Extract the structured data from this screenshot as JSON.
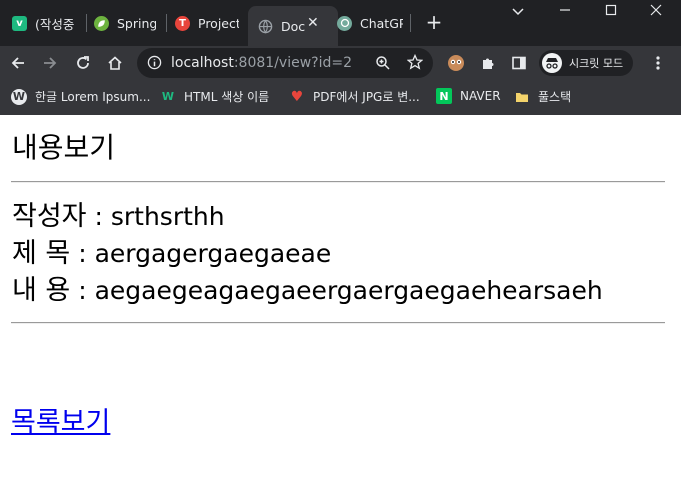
{
  "browser": {
    "tabs": [
      {
        "title": "(작성중",
        "favicon": "v-icon",
        "color": "#1eb980"
      },
      {
        "title": "Spring",
        "favicon": "spring-leaf-icon",
        "color": "#6db33f"
      },
      {
        "title": "Project",
        "favicon": "project-icon",
        "color": "#e8453c"
      },
      {
        "title": "Doc",
        "favicon": "globe-icon",
        "color": "#9aa0a6",
        "active": true
      },
      {
        "title": "ChatGP",
        "favicon": "chatgpt-icon",
        "color": "#74aa9c"
      }
    ],
    "address": {
      "host": "localhost",
      "path": ":8081/view?id=2"
    },
    "incognito_label": "시크릿 모드",
    "bookmarks": [
      {
        "label": "한글 Lorem Ipsum...",
        "icon": "wordpress-icon"
      },
      {
        "label": "HTML 색상 이름",
        "icon": "w-icon"
      },
      {
        "label": "PDF에서 JPG로 변...",
        "icon": "heart-icon"
      },
      {
        "label": "NAVER",
        "icon": "naver-icon"
      },
      {
        "label": "풀스택",
        "icon": "folder-icon"
      }
    ]
  },
  "page": {
    "heading": "내용보기",
    "author_label": "작성자",
    "author_value": " : srthsrthh",
    "title_label": "제 목",
    "title_value": " : aergagergaegaeae",
    "content_label": "내 용",
    "content_value": " : aegaegeagaegaeergaergaegaehearsaeh",
    "list_link": "목록보기"
  }
}
